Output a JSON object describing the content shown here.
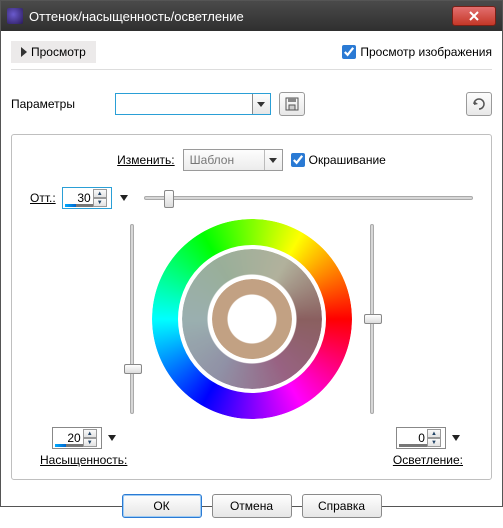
{
  "window": {
    "title": "Оттенок/насыщенность/осветление"
  },
  "preview": {
    "label": "Просмотр",
    "image_label": "Просмотр изображения",
    "image_checked": true
  },
  "params": {
    "label": "Параметры",
    "value": ""
  },
  "edit": {
    "label": "Изменить:",
    "template": "Шаблон",
    "colorize_label": "Окрашивание",
    "colorize_checked": true
  },
  "hue": {
    "label": "Отт.:",
    "value": "30"
  },
  "saturation": {
    "label": "Насыщенность:",
    "value": "20"
  },
  "lightness": {
    "label": "Осветление:",
    "value": "0"
  },
  "buttons": {
    "ok": "ОК",
    "cancel": "Отмена",
    "help": "Справка"
  },
  "icons": {
    "save": "save-icon",
    "reset": "reset-icon"
  }
}
